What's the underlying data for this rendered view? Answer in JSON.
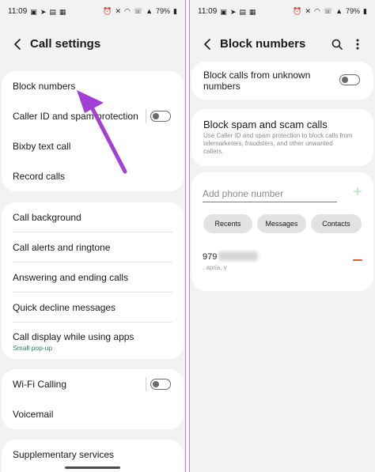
{
  "status": {
    "time": "11:09",
    "battery": "79%",
    "left_icons": [
      "gallery-icon",
      "send-icon",
      "image-icon",
      "grid-icon"
    ],
    "right_icons": [
      "alarm-icon",
      "mute-icon",
      "wifi-icon",
      "call-signal-icon",
      "signal-icon"
    ]
  },
  "left": {
    "title": "Call settings",
    "group1": [
      {
        "label": "Block numbers"
      },
      {
        "label": "Caller ID and spam protection",
        "toggle": false
      },
      {
        "label": "Bixby text call"
      },
      {
        "label": "Record calls"
      }
    ],
    "group2": [
      {
        "label": "Call background"
      },
      {
        "label": "Call alerts and ringtone"
      },
      {
        "label": "Answering and ending calls"
      },
      {
        "label": "Quick decline messages"
      },
      {
        "label": "Call display while using apps",
        "sub": "Small pop-up"
      }
    ],
    "group3": [
      {
        "label": "Wi-Fi Calling",
        "toggle": false
      },
      {
        "label": "Voicemail"
      }
    ],
    "group4": [
      {
        "label": "Supplementary services"
      }
    ]
  },
  "right": {
    "title": "Block numbers",
    "unknown": {
      "label": "Block calls from unknown numbers",
      "toggle": false
    },
    "spam": {
      "title": "Block spam and scam calls",
      "desc": "Use Caller ID and spam protection to block calls from telemarketers, fraudsters, and other unwanted callers."
    },
    "input": {
      "placeholder": "Add phone number",
      "value": ""
    },
    "pills": [
      "Recents",
      "Messages",
      "Contacts"
    ],
    "blocked": {
      "number": "979",
      "date": ". apria, v"
    }
  },
  "colors": {
    "accent": "#a23fd4",
    "remove": "#e2533d",
    "add": "#b3e6c5",
    "sub": "#1f8b4c"
  }
}
